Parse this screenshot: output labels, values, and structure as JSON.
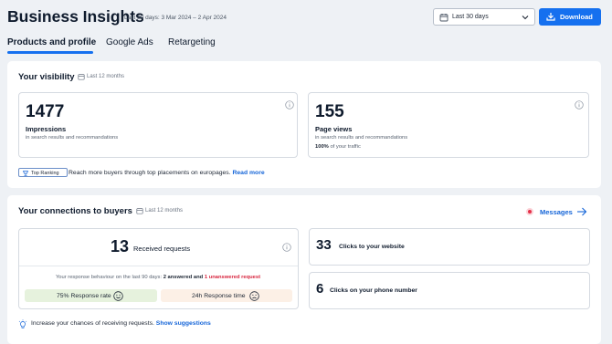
{
  "header": {
    "title": "Business Insights",
    "date_range": "Last 30 days: 3 Mar 2024 – 2 Apr 2024",
    "period_select": {
      "value": "Last 30 days"
    },
    "download_label": "Download"
  },
  "tabs": [
    {
      "label": "Products and profile",
      "active": true
    },
    {
      "label": "Google Ads",
      "active": false
    },
    {
      "label": "Retargeting",
      "active": false
    }
  ],
  "visibility": {
    "title": "Your visibility",
    "period": "Last 12 months",
    "impressions": {
      "value": "1477",
      "label": "Impressions",
      "desc": "in search results and recommandations"
    },
    "page_views": {
      "value": "155",
      "label": "Page views",
      "desc": "in search results and recommandations",
      "traffic_pct": "100%",
      "traffic_suffix": "of your traffic"
    },
    "badge": "Top Ranking",
    "promo_text": "Reach more buyers through top placements on europages.",
    "read_more": "Read more"
  },
  "connections": {
    "title": "Your connections to buyers",
    "period": "Last 12 months",
    "messages_label": "Messages",
    "received": {
      "value": "13",
      "label": "Received requests"
    },
    "response_line": {
      "prefix": "Your response behaviour on the last 90 days:",
      "answered": "2 answered",
      "and": "and",
      "unanswered": "1 unanswered request"
    },
    "response_rate": "75% Response rate",
    "response_time": "24h Response time",
    "website_clicks": {
      "value": "33",
      "label": "Clicks to your website"
    },
    "phone_clicks": {
      "value": "6",
      "label": "Clicks on your phone number"
    },
    "suggestion_text": "Increase your chances of receiving requests.",
    "show_suggestions": "Show suggestions"
  },
  "colors": {
    "accent": "#1570ef",
    "link": "#1565d8",
    "alert": "#e53049",
    "rate_bg": "#e6f2dd",
    "time_bg": "#fcf0e6"
  },
  "icons": [
    "calendar-icon",
    "chevron-down-icon",
    "download-icon",
    "info-icon",
    "trophy-icon",
    "arrow-right-icon",
    "smile-icon",
    "frown-icon",
    "lightbulb-icon"
  ]
}
